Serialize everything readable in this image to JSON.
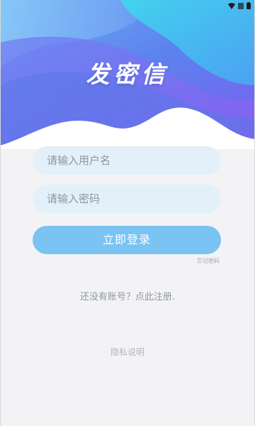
{
  "app": {
    "title": "发密信"
  },
  "login_form": {
    "username_placeholder": "请输入用户名",
    "password_placeholder": "请输入密码",
    "login_label": "立即登录",
    "forgot_label": "忘记密码"
  },
  "footer": {
    "register_label": "还没有账号？点此注册.",
    "privacy_label": "隐私说明"
  },
  "status_bar": {
    "icons": [
      "wifi-icon",
      "signal-icon",
      "battery-icon"
    ]
  },
  "colors": {
    "background": "#f3f3f5",
    "hero_blue": "#5f86f0",
    "hero_cyan": "#4fd7ef",
    "hero_purple": "#7b6cf0",
    "input_fill": "#e3f0fa",
    "button_fill": "#7ac3f2",
    "link_text": "#8e98a5"
  }
}
